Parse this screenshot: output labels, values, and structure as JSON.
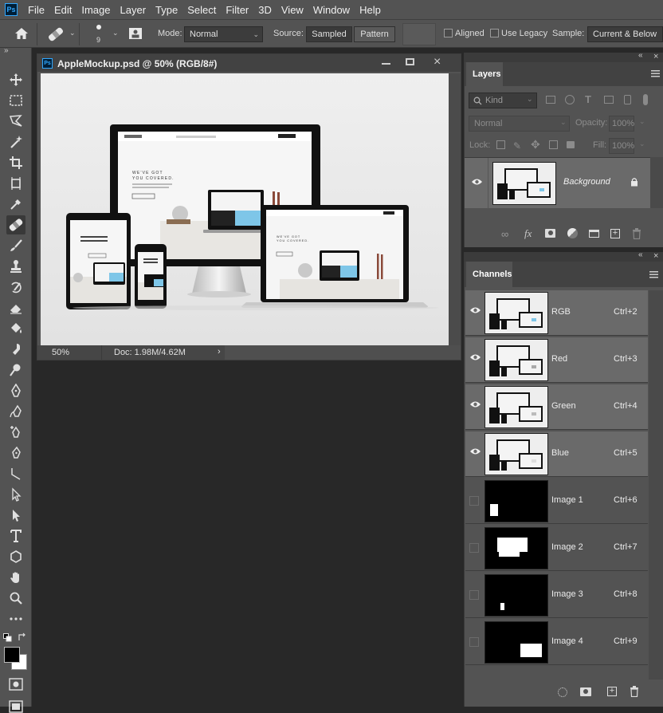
{
  "menu": {
    "items": [
      "File",
      "Edit",
      "Image",
      "Layer",
      "Type",
      "Select",
      "Filter",
      "3D",
      "View",
      "Window",
      "Help"
    ]
  },
  "options": {
    "brush_size": "9",
    "mode_label": "Mode:",
    "mode_value": "Normal",
    "source_label": "Source:",
    "sampled_label": "Sampled",
    "pattern_label": "Pattern",
    "aligned_label": "Aligned",
    "use_legacy_label": "Use Legacy",
    "sample_label": "Sample:",
    "sample_value": "Current & Below"
  },
  "document": {
    "title": "AppleMockup.psd @ 50% (RGB/8#)",
    "zoom": "50%",
    "doc_info": "Doc: 1.98M/4.62M"
  },
  "mockup": {
    "hero_line1": "WE'VE GOT",
    "hero_line2": "YOU COVERED."
  },
  "layers_panel": {
    "tab": "Layers",
    "filter_kind": "Kind",
    "blend_mode": "Normal",
    "opacity_label": "Opacity:",
    "opacity_value": "100%",
    "lock_label": "Lock:",
    "fill_label": "Fill:",
    "fill_value": "100%",
    "layer_name": "Background"
  },
  "channels_panel": {
    "tab": "Channels",
    "channels": [
      {
        "name": "RGB",
        "shortcut": "Ctrl+2"
      },
      {
        "name": "Red",
        "shortcut": "Ctrl+3"
      },
      {
        "name": "Green",
        "shortcut": "Ctrl+4"
      },
      {
        "name": "Blue",
        "shortcut": "Ctrl+5"
      },
      {
        "name": "Image 1",
        "shortcut": "Ctrl+6"
      },
      {
        "name": "Image 2",
        "shortcut": "Ctrl+7"
      },
      {
        "name": "Image 3",
        "shortcut": "Ctrl+8"
      },
      {
        "name": "Image 4",
        "shortcut": "Ctrl+9"
      }
    ]
  },
  "colors": {
    "ui_dark": "#535353",
    "workspace": "#282828",
    "selected_row": "#6a6a6a",
    "accent_blue": "#31a8ff"
  }
}
